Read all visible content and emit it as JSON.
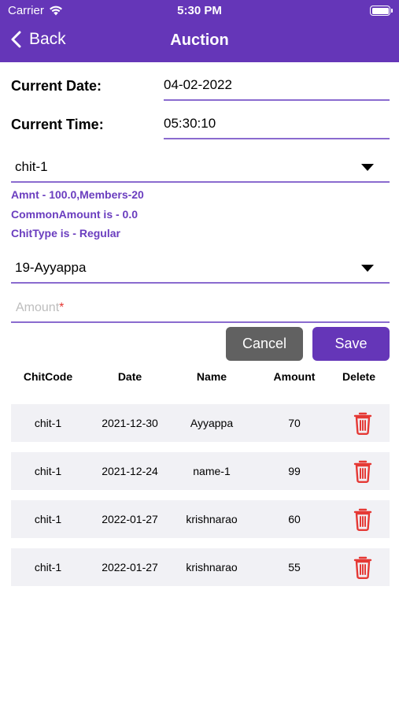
{
  "status_bar": {
    "carrier": "Carrier",
    "time": "5:30 PM"
  },
  "nav": {
    "back_label": "Back",
    "title": "Auction"
  },
  "form": {
    "current_date_label": "Current Date:",
    "current_date_value": "04-02-2022",
    "current_time_label": "Current Time:",
    "current_time_value": "05:30:10",
    "chit_select": "chit-1",
    "info_line1": "Amnt - 100.0,Members-20",
    "info_line2": "CommonAmount is - 0.0",
    "info_line3": "ChitType is - Regular",
    "member_select": "19-Ayyappa",
    "amount_placeholder": "Amount",
    "amount_required_mark": "*"
  },
  "buttons": {
    "cancel": "Cancel",
    "save": "Save"
  },
  "table": {
    "headers": [
      "ChitCode",
      "Date",
      "Name",
      "Amount",
      "Delete"
    ],
    "rows": [
      {
        "chitcode": "chit-1",
        "date": "2021-12-30",
        "name": "Ayyappa",
        "amount": "70"
      },
      {
        "chitcode": "chit-1",
        "date": "2021-12-24",
        "name": "name-1",
        "amount": "99"
      },
      {
        "chitcode": "chit-1",
        "date": "2022-01-27",
        "name": "krishnarao",
        "amount": "60"
      },
      {
        "chitcode": "chit-1",
        "date": "2022-01-27",
        "name": "krishnarao",
        "amount": "55"
      }
    ]
  },
  "colors": {
    "primary": "#6536b8",
    "cancel": "#616161",
    "delete": "#e53935",
    "row_bg": "#f1f1f5"
  },
  "icons": {
    "back": "chevron-left-icon",
    "delete": "trash-icon",
    "wifi": "wifi-icon",
    "battery": "battery-icon",
    "dropdown": "caret-down-icon"
  }
}
